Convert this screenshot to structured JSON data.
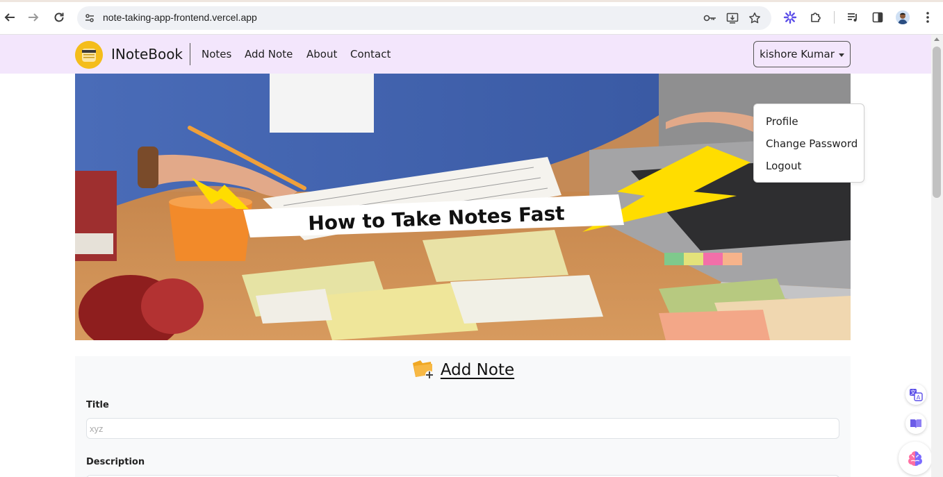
{
  "browser": {
    "url": "note-taking-app-frontend.vercel.app",
    "icons": [
      "back-icon",
      "forward-icon",
      "reload-icon",
      "site-settings-icon",
      "password-key-icon",
      "install-app-icon",
      "bookmark-star-icon",
      "extension-sparkle-icon",
      "extensions-puzzle-icon",
      "media-queue-icon",
      "side-panel-icon",
      "profile-avatar",
      "more-menu-icon"
    ]
  },
  "navbar": {
    "brand": "INoteBook",
    "links": [
      "Notes",
      "Add Note",
      "About",
      "Contact"
    ],
    "user_name": "kishore Kumar"
  },
  "dropdown": {
    "items": [
      "Profile",
      "Change Password",
      "Logout"
    ]
  },
  "hero": {
    "banner_text": "How to Take Notes Fast"
  },
  "add_note": {
    "heading": "Add Note",
    "title_label": "Title",
    "title_placeholder": "xyz",
    "description_label": "Description"
  },
  "colors": {
    "navbar_bg": "#f3e6fc",
    "logo_bg": "#f4bd1b",
    "form_bg": "#f8f9fa",
    "lightning": "#ffdd00"
  }
}
